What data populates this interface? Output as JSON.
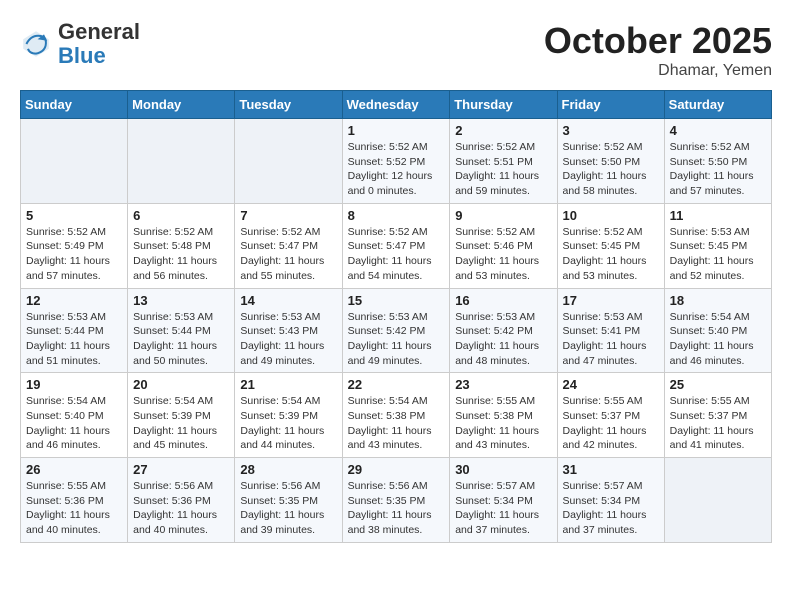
{
  "header": {
    "logo_general": "General",
    "logo_blue": "Blue",
    "month": "October 2025",
    "location": "Dhamar, Yemen"
  },
  "weekdays": [
    "Sunday",
    "Monday",
    "Tuesday",
    "Wednesday",
    "Thursday",
    "Friday",
    "Saturday"
  ],
  "weeks": [
    [
      {
        "day": "",
        "info": ""
      },
      {
        "day": "",
        "info": ""
      },
      {
        "day": "",
        "info": ""
      },
      {
        "day": "1",
        "info": "Sunrise: 5:52 AM\nSunset: 5:52 PM\nDaylight: 12 hours and 0 minutes."
      },
      {
        "day": "2",
        "info": "Sunrise: 5:52 AM\nSunset: 5:51 PM\nDaylight: 11 hours and 59 minutes."
      },
      {
        "day": "3",
        "info": "Sunrise: 5:52 AM\nSunset: 5:50 PM\nDaylight: 11 hours and 58 minutes."
      },
      {
        "day": "4",
        "info": "Sunrise: 5:52 AM\nSunset: 5:50 PM\nDaylight: 11 hours and 57 minutes."
      }
    ],
    [
      {
        "day": "5",
        "info": "Sunrise: 5:52 AM\nSunset: 5:49 PM\nDaylight: 11 hours and 57 minutes."
      },
      {
        "day": "6",
        "info": "Sunrise: 5:52 AM\nSunset: 5:48 PM\nDaylight: 11 hours and 56 minutes."
      },
      {
        "day": "7",
        "info": "Sunrise: 5:52 AM\nSunset: 5:47 PM\nDaylight: 11 hours and 55 minutes."
      },
      {
        "day": "8",
        "info": "Sunrise: 5:52 AM\nSunset: 5:47 PM\nDaylight: 11 hours and 54 minutes."
      },
      {
        "day": "9",
        "info": "Sunrise: 5:52 AM\nSunset: 5:46 PM\nDaylight: 11 hours and 53 minutes."
      },
      {
        "day": "10",
        "info": "Sunrise: 5:52 AM\nSunset: 5:45 PM\nDaylight: 11 hours and 53 minutes."
      },
      {
        "day": "11",
        "info": "Sunrise: 5:53 AM\nSunset: 5:45 PM\nDaylight: 11 hours and 52 minutes."
      }
    ],
    [
      {
        "day": "12",
        "info": "Sunrise: 5:53 AM\nSunset: 5:44 PM\nDaylight: 11 hours and 51 minutes."
      },
      {
        "day": "13",
        "info": "Sunrise: 5:53 AM\nSunset: 5:44 PM\nDaylight: 11 hours and 50 minutes."
      },
      {
        "day": "14",
        "info": "Sunrise: 5:53 AM\nSunset: 5:43 PM\nDaylight: 11 hours and 49 minutes."
      },
      {
        "day": "15",
        "info": "Sunrise: 5:53 AM\nSunset: 5:42 PM\nDaylight: 11 hours and 49 minutes."
      },
      {
        "day": "16",
        "info": "Sunrise: 5:53 AM\nSunset: 5:42 PM\nDaylight: 11 hours and 48 minutes."
      },
      {
        "day": "17",
        "info": "Sunrise: 5:53 AM\nSunset: 5:41 PM\nDaylight: 11 hours and 47 minutes."
      },
      {
        "day": "18",
        "info": "Sunrise: 5:54 AM\nSunset: 5:40 PM\nDaylight: 11 hours and 46 minutes."
      }
    ],
    [
      {
        "day": "19",
        "info": "Sunrise: 5:54 AM\nSunset: 5:40 PM\nDaylight: 11 hours and 46 minutes."
      },
      {
        "day": "20",
        "info": "Sunrise: 5:54 AM\nSunset: 5:39 PM\nDaylight: 11 hours and 45 minutes."
      },
      {
        "day": "21",
        "info": "Sunrise: 5:54 AM\nSunset: 5:39 PM\nDaylight: 11 hours and 44 minutes."
      },
      {
        "day": "22",
        "info": "Sunrise: 5:54 AM\nSunset: 5:38 PM\nDaylight: 11 hours and 43 minutes."
      },
      {
        "day": "23",
        "info": "Sunrise: 5:55 AM\nSunset: 5:38 PM\nDaylight: 11 hours and 43 minutes."
      },
      {
        "day": "24",
        "info": "Sunrise: 5:55 AM\nSunset: 5:37 PM\nDaylight: 11 hours and 42 minutes."
      },
      {
        "day": "25",
        "info": "Sunrise: 5:55 AM\nSunset: 5:37 PM\nDaylight: 11 hours and 41 minutes."
      }
    ],
    [
      {
        "day": "26",
        "info": "Sunrise: 5:55 AM\nSunset: 5:36 PM\nDaylight: 11 hours and 40 minutes."
      },
      {
        "day": "27",
        "info": "Sunrise: 5:56 AM\nSunset: 5:36 PM\nDaylight: 11 hours and 40 minutes."
      },
      {
        "day": "28",
        "info": "Sunrise: 5:56 AM\nSunset: 5:35 PM\nDaylight: 11 hours and 39 minutes."
      },
      {
        "day": "29",
        "info": "Sunrise: 5:56 AM\nSunset: 5:35 PM\nDaylight: 11 hours and 38 minutes."
      },
      {
        "day": "30",
        "info": "Sunrise: 5:57 AM\nSunset: 5:34 PM\nDaylight: 11 hours and 37 minutes."
      },
      {
        "day": "31",
        "info": "Sunrise: 5:57 AM\nSunset: 5:34 PM\nDaylight: 11 hours and 37 minutes."
      },
      {
        "day": "",
        "info": ""
      }
    ]
  ]
}
